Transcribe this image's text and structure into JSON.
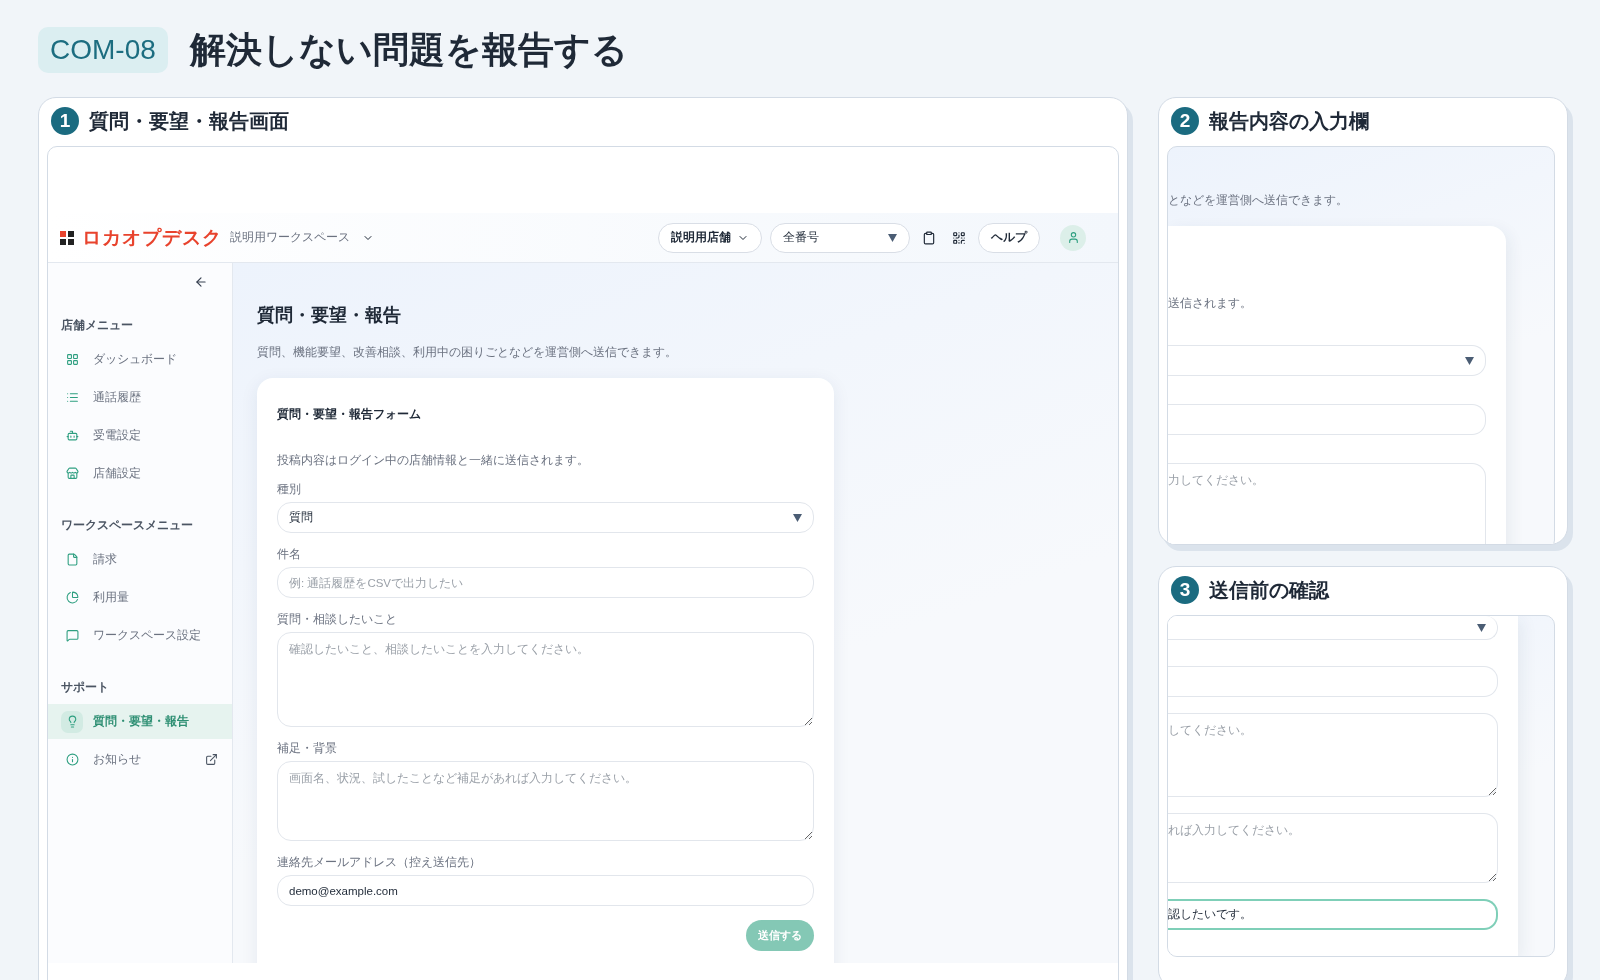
{
  "header": {
    "code": "COM-08",
    "title": "解決しない問題を報告する"
  },
  "panels": [
    {
      "number": "1",
      "title": "質問・要望・報告画面",
      "kind": "app"
    },
    {
      "number": "2",
      "title": "報告内容の入力欄",
      "kind": "crop"
    },
    {
      "number": "3",
      "title": "送信前の確認",
      "kind": "crop"
    }
  ],
  "app": {
    "topbar": {
      "logo": "ロカオプデスク",
      "workspace": "説明用ワークスペース",
      "store": "説明用店舗",
      "numbers": "全番号",
      "help": "ヘルプ"
    },
    "sidebar": [
      {
        "title": "店舗メニュー",
        "items": [
          {
            "label": "ダッシュボード",
            "selected": false,
            "external": false
          },
          {
            "label": "通話履歴",
            "selected": false,
            "external": false
          },
          {
            "label": "受電設定",
            "selected": false,
            "external": false
          },
          {
            "label": "店舗設定",
            "selected": false,
            "external": false
          }
        ]
      },
      {
        "title": "ワークスペースメニュー",
        "items": [
          {
            "label": "請求",
            "selected": false,
            "external": false
          },
          {
            "label": "利用量",
            "selected": false,
            "external": false
          },
          {
            "label": "ワークスペース設定",
            "selected": false,
            "external": false
          }
        ]
      },
      {
        "title": "サポート",
        "items": [
          {
            "label": "質問・要望・報告",
            "selected": true,
            "external": false
          },
          {
            "label": "お知らせ",
            "selected": false,
            "external": true
          }
        ]
      }
    ],
    "page": {
      "title": "質問・要望・報告",
      "description": "質問、機能要望、改善相談、利用中の困りごとなどを運営側へ送信できます。",
      "form": {
        "title": "質問・要望・報告フォーム",
        "note": "投稿内容はログイン中の店舗情報と一緒に送信されます。",
        "fields": [
          {
            "label": "種別",
            "kind": "select",
            "value": "質問"
          },
          {
            "label": "件名",
            "kind": "input",
            "placeholder": "例: 通話履歴をCSVで出力したい"
          },
          {
            "label": "質問・相談したいこと",
            "kind": "textarea",
            "placeholder": "確認したいこと、相談したいことを入力してください。"
          },
          {
            "label": "補足・背景",
            "kind": "textarea",
            "placeholder": "画面名、状況、試したことなど補足があれば入力してください。"
          },
          {
            "label": "連絡先メールアドレス（控え送信先）",
            "kind": "input",
            "value": "demo@example.com"
          }
        ],
        "submit": {
          "label": "送信する",
          "disabled": true
        }
      }
    }
  },
  "crops": [
    {
      "description": "となどを運営側へ送信できます。",
      "note": "送信されます。",
      "fields": [
        {
          "kind": "select"
        },
        {
          "kind": "input"
        },
        {
          "kind": "textarea",
          "placeholder": "力してください。"
        }
      ]
    },
    {
      "fields": [
        {
          "kind": "select"
        },
        {
          "kind": "input"
        },
        {
          "kind": "textarea",
          "placeholder": "してください。"
        },
        {
          "kind": "textarea",
          "placeholder": "れば入力してください。"
        },
        {
          "kind": "input",
          "value": "認したいです。",
          "focused": true
        }
      ]
    }
  ]
}
